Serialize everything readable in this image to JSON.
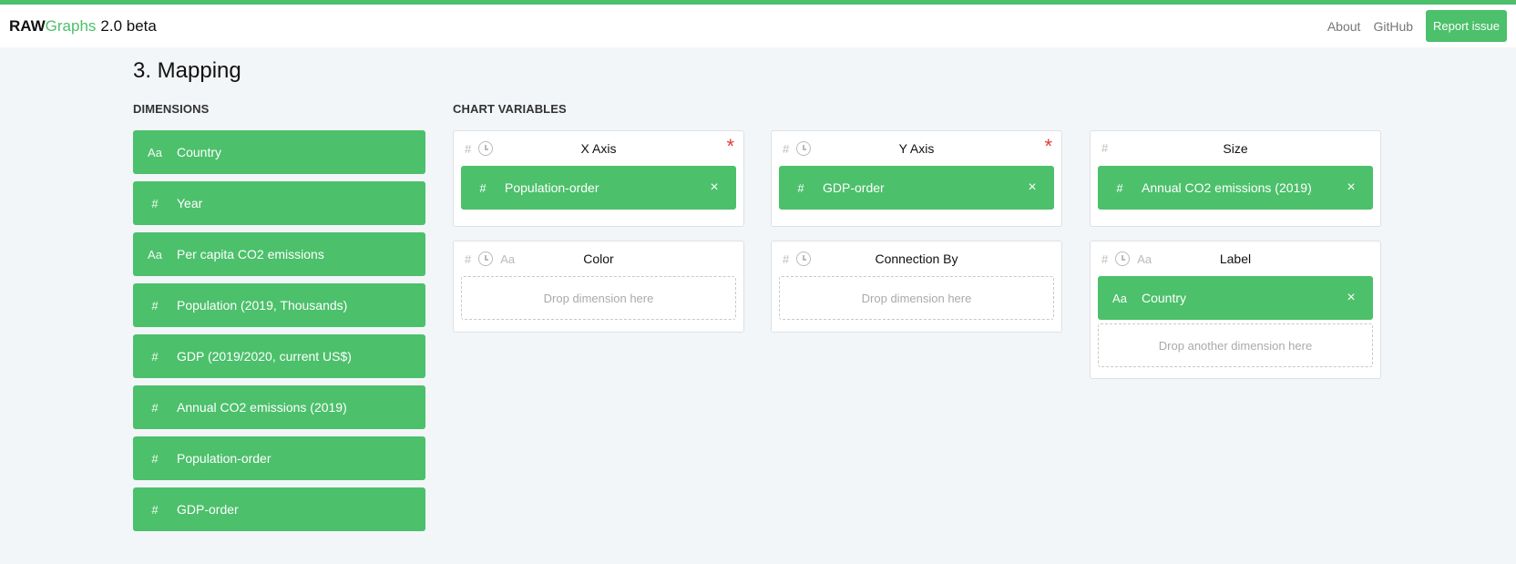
{
  "header": {
    "brand_raw": "RAW",
    "brand_graphs": "Graphs",
    "brand_version": "2.0 beta",
    "nav_about": "About",
    "nav_github": "GitHub",
    "report_issue": "Report issue"
  },
  "section": {
    "title": "3. Mapping",
    "dimensions_label": "DIMENSIONS",
    "chart_variables_label": "CHART VARIABLES"
  },
  "dimensions": [
    {
      "type": "Aa",
      "label": "Country"
    },
    {
      "type": "#",
      "label": "Year"
    },
    {
      "type": "Aa",
      "label": "Per capita CO2 emissions"
    },
    {
      "type": "#",
      "label": "Population (2019, Thousands)"
    },
    {
      "type": "#",
      "label": "GDP (2019/2020, current US$)"
    },
    {
      "type": "#",
      "label": "Annual CO2 emissions (2019)"
    },
    {
      "type": "#",
      "label": "Population-order"
    },
    {
      "type": "#",
      "label": "GDP-order"
    }
  ],
  "variables": {
    "x_axis": {
      "title": "X Axis",
      "required": "*",
      "icon_hash": "#",
      "chip_type": "#",
      "chip_label": "Population-order",
      "chip_remove": "×"
    },
    "y_axis": {
      "title": "Y Axis",
      "required": "*",
      "icon_hash": "#",
      "chip_type": "#",
      "chip_label": "GDP-order",
      "chip_remove": "×"
    },
    "size": {
      "title": "Size",
      "icon_hash": "#",
      "chip_type": "#",
      "chip_label": "Annual CO2 emissions (2019)",
      "chip_remove": "×"
    },
    "color": {
      "title": "Color",
      "icon_hash": "#",
      "icon_text": "Aa",
      "drop_text": "Drop dimension here"
    },
    "connection_by": {
      "title": "Connection By",
      "icon_hash": "#",
      "drop_text": "Drop dimension here"
    },
    "label": {
      "title": "Label",
      "icon_hash": "#",
      "icon_text": "Aa",
      "chip_type": "Aa",
      "chip_label": "Country",
      "chip_remove": "×",
      "drop_text": "Drop another dimension here"
    }
  },
  "colors": {
    "accent": "#4cc06b",
    "required": "#e03c3c",
    "background": "#f3f6f9"
  }
}
